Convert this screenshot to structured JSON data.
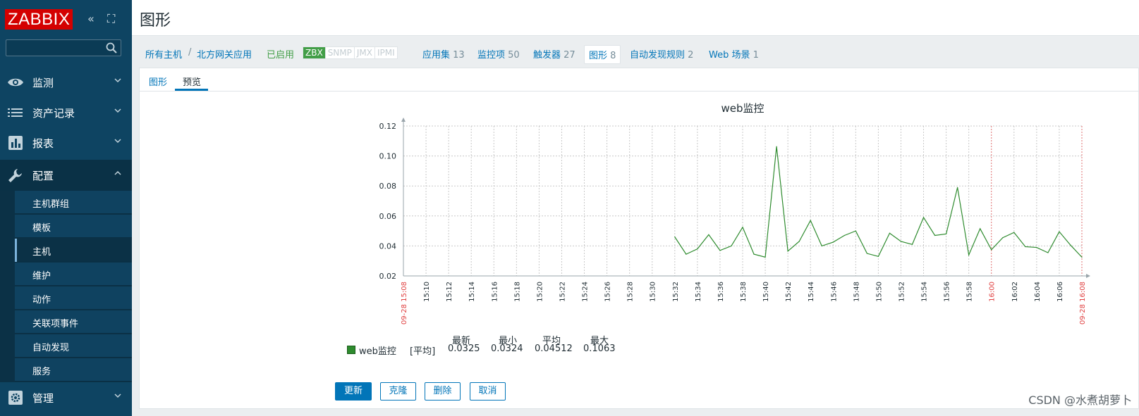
{
  "sidebar": {
    "logo": "ZABBIX",
    "collapse_icon": "«",
    "kiosk_icon": "⛶",
    "search": {
      "value": "",
      "placeholder": ""
    },
    "menu": [
      {
        "label": "监测",
        "icon": "eye-icon",
        "expanded": false
      },
      {
        "label": "资产记录",
        "icon": "list-icon",
        "expanded": false
      },
      {
        "label": "报表",
        "icon": "report-icon",
        "expanded": false
      },
      {
        "label": "配置",
        "icon": "wrench-icon",
        "expanded": true
      },
      {
        "label": "管理",
        "icon": "gear-icon",
        "expanded": false
      }
    ],
    "submenu": [
      "主机群组",
      "模板",
      "主机",
      "维护",
      "动作",
      "关联项事件",
      "自动发现",
      "服务"
    ],
    "selected_submenu": "主机"
  },
  "header": {
    "title": "图形"
  },
  "host_nav": {
    "breadcrumb_all": "所有主机",
    "breadcrumb_sep": "/",
    "host": "北方网关应用",
    "status": "已启用",
    "availability": [
      "ZBX",
      "SNMP",
      "JMX",
      "IPMI"
    ],
    "links": [
      {
        "label": "应用集",
        "count": "13"
      },
      {
        "label": "监控项",
        "count": "50"
      },
      {
        "label": "触发器",
        "count": "27"
      },
      {
        "label": "图形",
        "count": "8"
      },
      {
        "label": "自动发现规则",
        "count": "2"
      },
      {
        "label": "Web 场景",
        "count": "1"
      }
    ]
  },
  "tabs": [
    "图形",
    "预览"
  ],
  "active_tab": "预览",
  "chart_data": {
    "type": "line",
    "title": "web监控",
    "ylim": [
      0.02,
      0.12
    ],
    "y_ticks": [
      "0.12",
      "0.10",
      "0.08",
      "0.06",
      "0.04",
      "0.02"
    ],
    "x_tick_labels": [
      "09-28 15:08",
      "15:10",
      "15:12",
      "15:14",
      "15:16",
      "15:18",
      "15:20",
      "15:22",
      "15:24",
      "15:26",
      "15:28",
      "15:30",
      "15:32",
      "15:34",
      "15:36",
      "15:38",
      "15:40",
      "15:42",
      "15:44",
      "15:46",
      "15:48",
      "15:50",
      "15:52",
      "15:54",
      "15:56",
      "15:58",
      "16:00",
      "16:02",
      "16:04",
      "16:06",
      "09-28 16:08"
    ],
    "highlight_ticks": [
      "09-28 15:08",
      "16:00",
      "09-28 16:08"
    ],
    "grid": true,
    "series": [
      {
        "name": "web监控",
        "color": "#2e8b2e",
        "x_minutes": [
          24,
          25,
          26,
          27,
          28,
          29,
          30,
          31,
          32,
          33,
          34,
          35,
          36,
          37,
          38,
          39,
          40,
          41,
          42,
          43,
          44,
          45,
          46,
          47,
          48,
          49,
          50,
          51,
          52,
          53,
          54,
          55,
          56,
          57,
          58,
          59,
          60
        ],
        "values": [
          0.046,
          0.0345,
          0.038,
          0.0475,
          0.037,
          0.04,
          0.0525,
          0.0345,
          0.0325,
          0.1063,
          0.0365,
          0.043,
          0.057,
          0.04,
          0.0425,
          0.047,
          0.05,
          0.035,
          0.033,
          0.0485,
          0.043,
          0.041,
          0.059,
          0.047,
          0.048,
          0.079,
          0.034,
          0.0515,
          0.0375,
          0.0455,
          0.049,
          0.0395,
          0.039,
          0.0355,
          0.0495,
          0.0405,
          0.0325
        ]
      }
    ],
    "legend": {
      "name": "web监控",
      "func": "[平均]",
      "headers": [
        "最新",
        "最小",
        "平均",
        "最大"
      ],
      "values": [
        "0.0325",
        "0.0324",
        "0.04512",
        "0.1063"
      ]
    }
  },
  "buttons": {
    "update": "更新",
    "clone": "克隆",
    "delete": "删除",
    "cancel": "取消"
  },
  "watermark": "CSDN @水煮胡萝卜"
}
